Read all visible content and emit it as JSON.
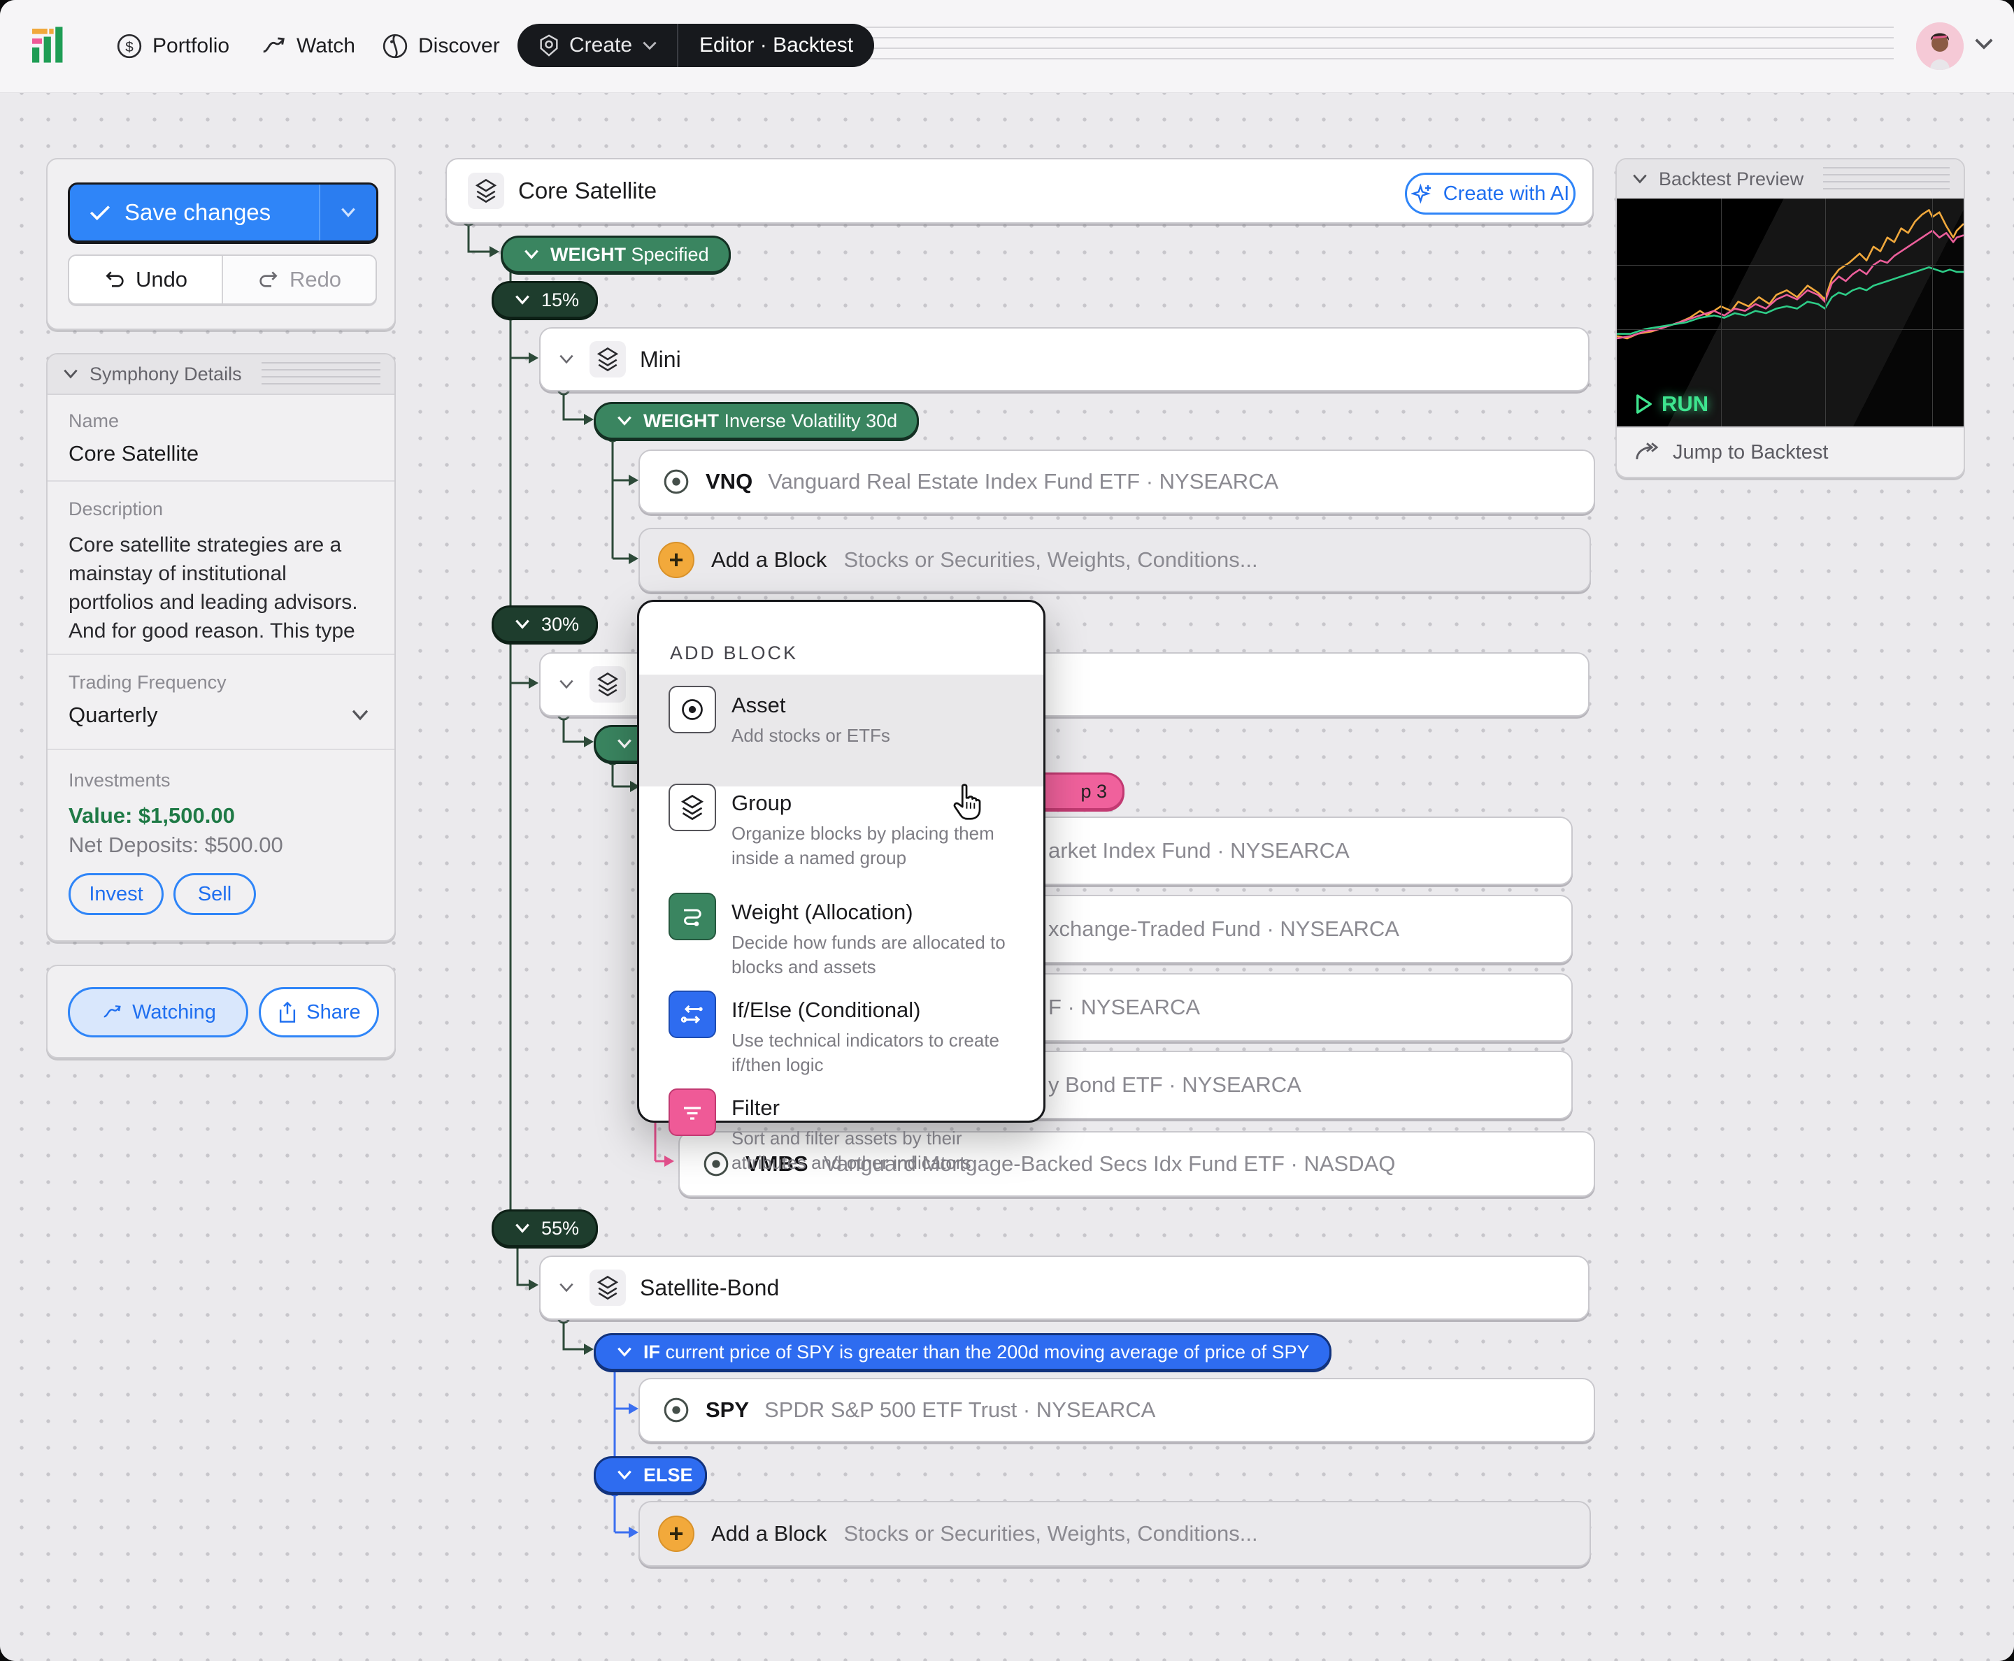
{
  "navbar": {
    "portfolio": "Portfolio",
    "watch": "Watch",
    "discover": "Discover",
    "create": "Create",
    "editor_tab": "Editor · Backtest"
  },
  "actions": {
    "save": "Save changes",
    "undo": "Undo",
    "redo": "Redo"
  },
  "details": {
    "title": "Symphony Details",
    "name_label": "Name",
    "name_value": "Core Satellite",
    "description_label": "Description",
    "description_lines": [
      "Core satellite strategies are a",
      "mainstay of institutional",
      "portfolios and leading advisors.",
      "And for good reason. This type"
    ],
    "trading_frequency_label": "Trading Frequency",
    "trading_frequency_value": "Quarterly",
    "investments_label": "Investments",
    "value_text": "Value: $1,500.00",
    "net_deposits_text": "Net Deposits: $500.00",
    "invest": "Invest",
    "sell": "Sell"
  },
  "watch_panel": {
    "watching": "Watching",
    "share": "Share"
  },
  "tree": {
    "root_title": "Core Satellite",
    "create_ai": "Create with AI",
    "weight_specified": {
      "bold": "WEIGHT",
      "rest": "Specified"
    },
    "pct15": "15%",
    "pct30": "30%",
    "pct55": "55%",
    "mini": "Mini",
    "weight_inverse": {
      "bold": "WEIGHT",
      "rest": "Inverse Volatility 30d"
    },
    "vnq": {
      "ticker": "VNQ",
      "name": "Vanguard Real Estate Index Fund ETF · NYSEARCA"
    },
    "add_block": {
      "title": "Add a Block",
      "hint": "Stocks or Securities, Weights, Conditions..."
    },
    "badge_fragment": "p 3",
    "partial_rows": [
      "arket Index Fund · NYSEARCA",
      "xchange-Traded Fund · NYSEARCA",
      "F · NYSEARCA",
      "y Bond ETF · NYSEARCA"
    ],
    "vmbs": {
      "ticker": "VMBS",
      "name": "Vanguard Mortgage-Backed Secs Idx Fund ETF · NASDAQ"
    },
    "satellite_bond": "Satellite-Bond",
    "if_cond": {
      "bold": "IF",
      "rest": "current price of SPY is greater than the 200d moving average of price of SPY"
    },
    "spy": {
      "ticker": "SPY",
      "name": "SPDR S&P 500 ETF Trust · NYSEARCA"
    },
    "else_label": "ELSE"
  },
  "popup": {
    "header": "ADD BLOCK",
    "items": [
      {
        "title": "Asset",
        "desc": "Add stocks or ETFs"
      },
      {
        "title": "Group",
        "desc": "Organize blocks by placing them inside a named group"
      },
      {
        "title": "Weight (Allocation)",
        "desc": "Decide how funds are allocated to blocks and assets"
      },
      {
        "title": "If/Else (Conditional)",
        "desc": "Use technical indicators to create if/then logic"
      },
      {
        "title": "Filter",
        "desc": "Sort and filter assets by their attributes and other indicators"
      }
    ]
  },
  "preview": {
    "title": "Backtest Preview",
    "run": "RUN",
    "jump": "Jump to Backtest"
  },
  "colors": {
    "accent_blue": "#2f85f8",
    "pill_green": "#3a8560",
    "pill_dark_green": "#1e3d2d",
    "pill_blue": "#2e6cf0",
    "filter_pink": "#ef5a97",
    "add_orange": "#f2a93b",
    "value_green": "#1f7a46",
    "run_green": "#3ee58f"
  },
  "chart_data": {
    "type": "line",
    "title": "Backtest Preview equity curves (unlabeled sparkline)",
    "xlabel": "",
    "ylabel": "",
    "grid": true,
    "x_range_pct": [
      0,
      100
    ],
    "y_range_pct": [
      0,
      100
    ],
    "gridlines": {
      "vertical_pct": [
        30,
        60,
        91
      ],
      "horizontal_pct": [
        29,
        57
      ]
    },
    "series": [
      {
        "name": "orange",
        "color": "#f0a83c",
        "points": [
          [
            0,
            60
          ],
          [
            3,
            61
          ],
          [
            6,
            59
          ],
          [
            10,
            58
          ],
          [
            14,
            56
          ],
          [
            18,
            54
          ],
          [
            21,
            52
          ],
          [
            24,
            49
          ],
          [
            26,
            51
          ],
          [
            30,
            47
          ],
          [
            33,
            49
          ],
          [
            35,
            45
          ],
          [
            38,
            47
          ],
          [
            41,
            43
          ],
          [
            44,
            46
          ],
          [
            46,
            42
          ],
          [
            49,
            40
          ],
          [
            52,
            43
          ],
          [
            55,
            38
          ],
          [
            58,
            41
          ],
          [
            60,
            44
          ],
          [
            62,
            35
          ],
          [
            64,
            31
          ],
          [
            67,
            28
          ],
          [
            70,
            24
          ],
          [
            72,
            27
          ],
          [
            74,
            21
          ],
          [
            76,
            23
          ],
          [
            78,
            17
          ],
          [
            80,
            19
          ],
          [
            82,
            13
          ],
          [
            84,
            15
          ],
          [
            86,
            10
          ],
          [
            88,
            7
          ],
          [
            90,
            5
          ],
          [
            91,
            8
          ],
          [
            93,
            6
          ],
          [
            95,
            12
          ],
          [
            97,
            17
          ],
          [
            98,
            14
          ],
          [
            100,
            11
          ]
        ]
      },
      {
        "name": "pink",
        "color": "#ec5f9b",
        "points": [
          [
            0,
            61
          ],
          [
            4,
            60
          ],
          [
            8,
            58
          ],
          [
            12,
            57
          ],
          [
            16,
            55
          ],
          [
            20,
            53
          ],
          [
            24,
            51
          ],
          [
            28,
            49
          ],
          [
            31,
            51
          ],
          [
            34,
            48
          ],
          [
            37,
            49
          ],
          [
            40,
            46
          ],
          [
            43,
            48
          ],
          [
            46,
            44
          ],
          [
            49,
            42
          ],
          [
            52,
            44
          ],
          [
            55,
            40
          ],
          [
            58,
            42
          ],
          [
            60,
            45
          ],
          [
            62,
            37
          ],
          [
            64,
            34
          ],
          [
            66,
            36
          ],
          [
            68,
            33
          ],
          [
            70,
            31
          ],
          [
            72,
            33
          ],
          [
            74,
            29
          ],
          [
            76,
            27
          ],
          [
            78,
            28
          ],
          [
            80,
            25
          ],
          [
            82,
            23
          ],
          [
            84,
            21
          ],
          [
            86,
            19
          ],
          [
            88,
            17
          ],
          [
            90,
            15
          ],
          [
            91,
            14
          ],
          [
            93,
            17
          ],
          [
            95,
            15
          ],
          [
            97,
            19
          ],
          [
            98,
            17
          ],
          [
            100,
            16
          ]
        ]
      },
      {
        "name": "green",
        "color": "#2ecc87",
        "points": [
          [
            0,
            59
          ],
          [
            4,
            59
          ],
          [
            8,
            57
          ],
          [
            12,
            56
          ],
          [
            16,
            55
          ],
          [
            20,
            54
          ],
          [
            24,
            52
          ],
          [
            28,
            51
          ],
          [
            31,
            52
          ],
          [
            34,
            50
          ],
          [
            37,
            51
          ],
          [
            40,
            49
          ],
          [
            43,
            50
          ],
          [
            46,
            48
          ],
          [
            49,
            47
          ],
          [
            52,
            48
          ],
          [
            55,
            45
          ],
          [
            58,
            46
          ],
          [
            60,
            48
          ],
          [
            62,
            43
          ],
          [
            64,
            41
          ],
          [
            66,
            42
          ],
          [
            68,
            40
          ],
          [
            70,
            39
          ],
          [
            72,
            40
          ],
          [
            74,
            38
          ],
          [
            76,
            37
          ],
          [
            78,
            36
          ],
          [
            80,
            35
          ],
          [
            82,
            34
          ],
          [
            84,
            33
          ],
          [
            86,
            32
          ],
          [
            88,
            31
          ],
          [
            90,
            30
          ],
          [
            92,
            31
          ],
          [
            94,
            32
          ],
          [
            96,
            31
          ],
          [
            98,
            32
          ],
          [
            100,
            32
          ]
        ]
      }
    ]
  }
}
